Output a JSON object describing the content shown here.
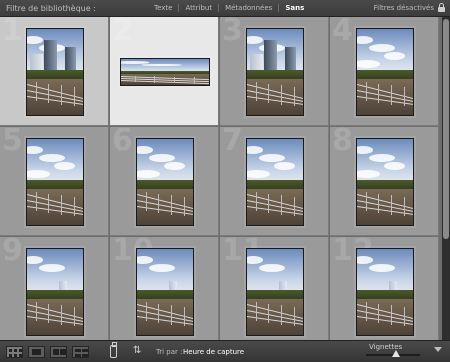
{
  "filterbar": {
    "title": "Filtre de bibliothèque :",
    "tabs": [
      {
        "label": "Texte",
        "active": false
      },
      {
        "label": "Attribut",
        "active": false
      },
      {
        "label": "Métadonnées",
        "active": false
      },
      {
        "label": "Sans",
        "active": true
      }
    ],
    "status": "Filtres désactivés"
  },
  "grid": {
    "cells": [
      {
        "number": "1",
        "state": "selected",
        "orientation": "portrait",
        "scene": "towers"
      },
      {
        "number": "2",
        "state": "primary",
        "orientation": "landscape",
        "scene": "panorama"
      },
      {
        "number": "3",
        "state": "normal",
        "orientation": "portrait",
        "scene": "towers"
      },
      {
        "number": "4",
        "state": "normal",
        "orientation": "portrait",
        "scene": "clouds"
      },
      {
        "number": "5",
        "state": "normal",
        "orientation": "portrait",
        "scene": "clouds"
      },
      {
        "number": "6",
        "state": "normal",
        "orientation": "portrait",
        "scene": "clouds"
      },
      {
        "number": "7",
        "state": "normal",
        "orientation": "portrait",
        "scene": "clouds"
      },
      {
        "number": "8",
        "state": "normal",
        "orientation": "portrait",
        "scene": "clouds"
      },
      {
        "number": "9",
        "state": "normal",
        "orientation": "portrait",
        "scene": "bridge"
      },
      {
        "number": "10",
        "state": "normal",
        "orientation": "portrait",
        "scene": "bridge"
      },
      {
        "number": "11",
        "state": "normal",
        "orientation": "portrait",
        "scene": "bridge"
      },
      {
        "number": "12",
        "state": "normal",
        "orientation": "portrait",
        "scene": "bridge"
      }
    ]
  },
  "toolbar": {
    "sort_label": "Tri par :",
    "sort_value": "Heure de capture",
    "thumbnail_label": "Vignettes",
    "thumbnail_size": 0.55
  }
}
